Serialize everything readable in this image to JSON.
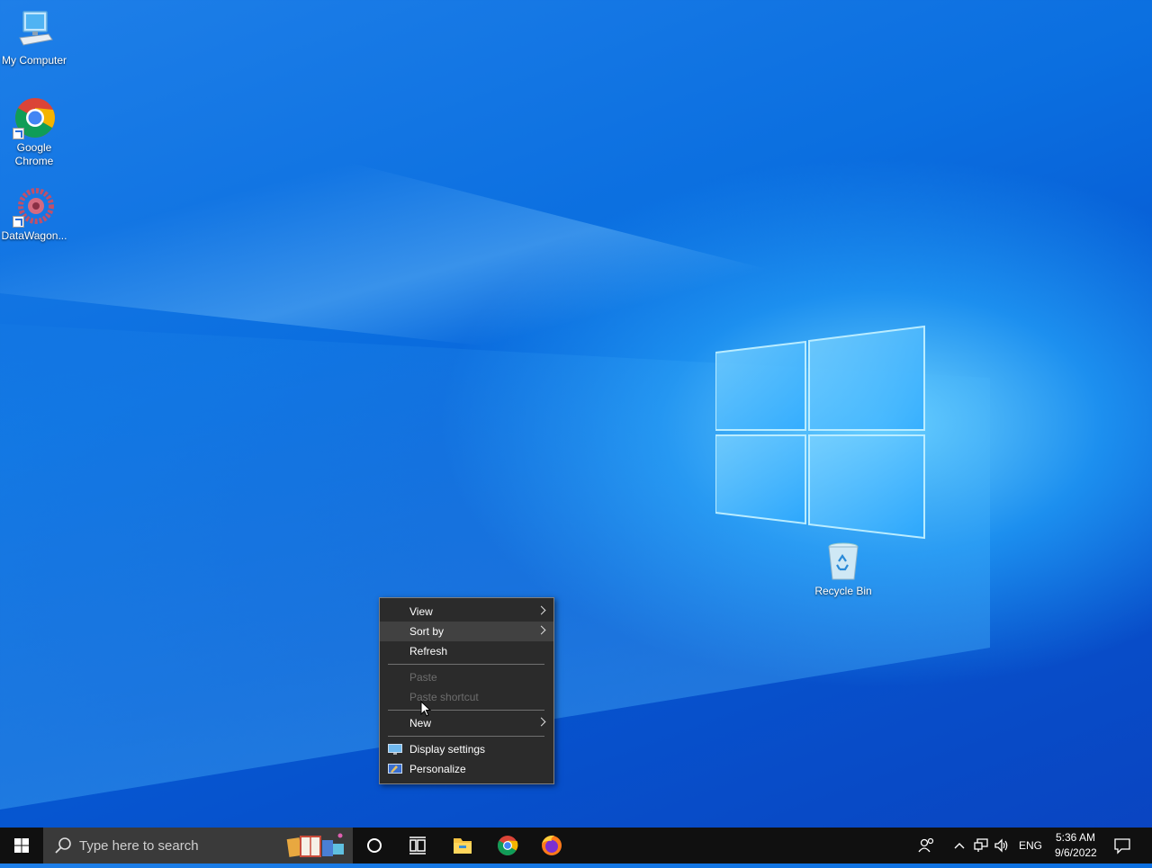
{
  "desktop": {
    "icons": [
      {
        "label": "My Computer",
        "icon": "computer-icon"
      },
      {
        "label": "Google Chrome",
        "icon": "chrome-icon"
      },
      {
        "label": "DataWagon...",
        "icon": "datawagon-icon"
      },
      {
        "label": "Recycle Bin",
        "icon": "recycle-bin-icon"
      }
    ]
  },
  "context_menu": {
    "items": [
      {
        "label": "View",
        "submenu": true,
        "disabled": false
      },
      {
        "label": "Sort by",
        "submenu": true,
        "disabled": false,
        "highlighted": true
      },
      {
        "label": "Refresh",
        "submenu": false,
        "disabled": false
      },
      {
        "label": "Paste",
        "submenu": false,
        "disabled": true
      },
      {
        "label": "Paste shortcut",
        "submenu": false,
        "disabled": true
      },
      {
        "label": "New",
        "submenu": true,
        "disabled": false
      },
      {
        "label": "Display settings",
        "submenu": false,
        "disabled": false,
        "icon": "display-icon"
      },
      {
        "label": "Personalize",
        "submenu": false,
        "disabled": false,
        "icon": "personalize-icon"
      }
    ]
  },
  "taskbar": {
    "search_placeholder": "Type here to search",
    "language": "ENG",
    "time": "5:36 AM",
    "date": "9/6/2022"
  },
  "colors": {
    "taskbar_bg": "#101010",
    "menu_bg": "#2b2b2b",
    "menu_hover": "#414141",
    "desktop_blue": "#0b6fe0"
  }
}
